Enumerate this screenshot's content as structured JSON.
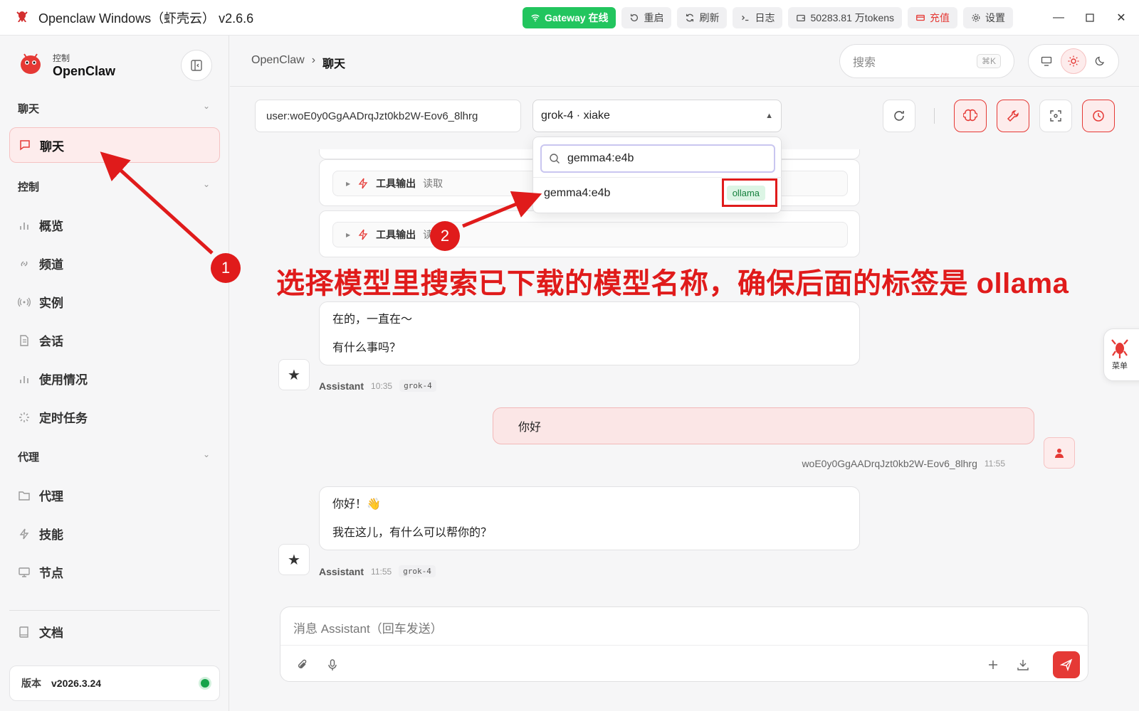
{
  "titlebar": {
    "title": "Openclaw Windows（虾壳云） v2.6.6",
    "gateway": "Gateway 在线",
    "restart": "重启",
    "refresh": "刷新",
    "logs": "日志",
    "tokens": "50283.81 万tokens",
    "recharge": "充值",
    "settings": "设置"
  },
  "sidebar": {
    "brand_sub": "控制",
    "brand_name": "OpenClaw",
    "sections": {
      "chat": "聊天",
      "control": "控制",
      "agent": "代理"
    },
    "items": {
      "chat": "聊天",
      "overview": "概览",
      "channels": "频道",
      "instances": "实例",
      "sessions": "会话",
      "usage": "使用情况",
      "cron": "定时任务",
      "agents": "代理",
      "skills": "技能",
      "nodes": "节点",
      "docs": "文档"
    },
    "version_label": "版本",
    "version_value": "v2026.3.24"
  },
  "header": {
    "crumb_root": "OpenClaw",
    "crumb_sep": "›",
    "crumb_current": "聊天",
    "search_placeholder": "搜索",
    "search_kbd": "⌘K"
  },
  "toolbar": {
    "session_value": "user:woE0y0GgAADrqJzt0kb2W-Eov6_8lhrg",
    "model_value": "grok-4 · xiake"
  },
  "dropdown": {
    "search_value": "gemma4:e4b",
    "option_name": "gemma4:e4b",
    "option_tag": "ollama"
  },
  "chat": {
    "tool_title": "工具输出",
    "tool_sub_1": "读取",
    "tool_sub_2": "读",
    "msg1_line1": "在的，一直在～",
    "msg1_line2": "有什么事吗？",
    "msg1_author": "Assistant",
    "msg1_time": "10:35",
    "msg1_model": "grok-4",
    "user_msg": "你好",
    "user_name": "woE0y0GgAADrqJzt0kb2W-Eov6_8lhrg",
    "user_time": "11:55",
    "msg2_line1": "你好！👋",
    "msg2_line2": "我在这儿，有什么可以帮你的？",
    "msg2_author": "Assistant",
    "msg2_time": "11:55",
    "msg2_model": "grok-4"
  },
  "composer": {
    "placeholder": "消息 Assistant（回车发送）"
  },
  "float_menu": {
    "label": "菜单"
  },
  "annotations": {
    "text": "选择模型里搜索已下载的模型名称，确保后面的标签是 ollama",
    "badge1": "1",
    "badge2": "2",
    "color": "#e01b1b"
  },
  "colors": {
    "accent": "#e53935",
    "gateway_green": "#22c55e",
    "ollama_tag_bg": "#dcf5e5"
  }
}
